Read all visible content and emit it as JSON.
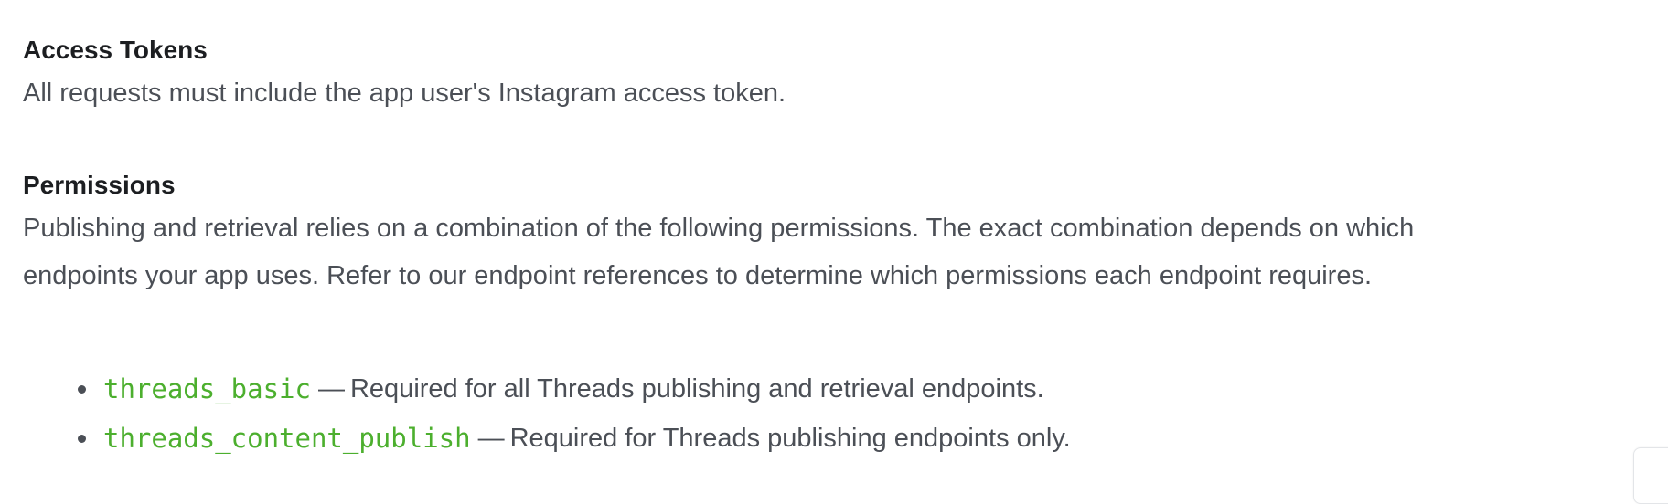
{
  "access_tokens": {
    "heading": "Access Tokens",
    "body": "All requests must include the app user's Instagram access token."
  },
  "permissions": {
    "heading": "Permissions",
    "body_line1": "Publishing and retrieval relies on a combination of the following permissions. The exact combination depends on which",
    "body_line2": "endpoints your app uses. Refer to our endpoint references to determine which permissions each endpoint requires.",
    "items": [
      {
        "code": "threads_basic",
        "separator": "—",
        "description": "Required for all Threads publishing and retrieval endpoints."
      },
      {
        "code": "threads_content_publish",
        "separator": "—",
        "description": "Required for Threads publishing endpoints only."
      }
    ]
  },
  "colors": {
    "heading": "#1c1e21",
    "body_text": "#4b4f56",
    "code": "#4caf2e"
  }
}
